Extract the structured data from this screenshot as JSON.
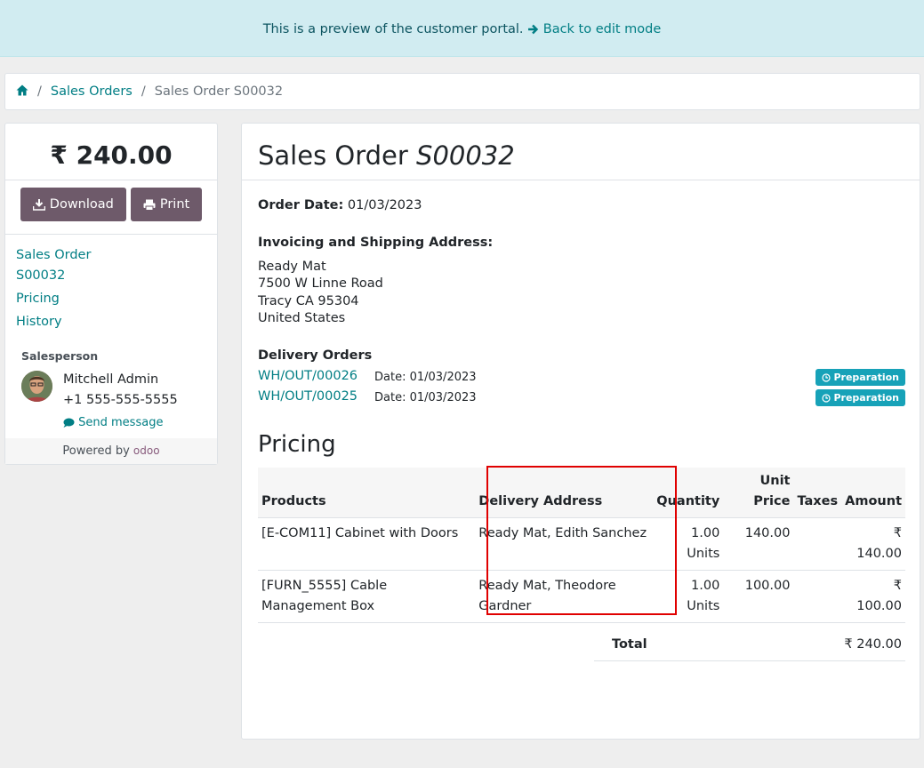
{
  "banner": {
    "text": "This is a preview of the customer portal.",
    "link": "Back to edit mode"
  },
  "breadcrumb": {
    "item1": "Sales Orders",
    "current": "Sales Order S00032"
  },
  "sidebar": {
    "amount": "₹ 240.00",
    "download_label": "Download",
    "print_label": "Print",
    "nav": [
      "Sales Order",
      "S00032",
      "Pricing",
      "History"
    ],
    "salesperson_label": "Salesperson",
    "salesperson_name": "Mitchell Admin",
    "salesperson_phone": "+1 555-555-5555",
    "send_message": "Send message",
    "powered_by": "Powered by",
    "odoo": "odoo"
  },
  "order": {
    "title_prefix": "Sales Order",
    "title_ref": "S00032",
    "order_date_label": "Order Date:",
    "order_date": "01/03/2023",
    "address_heading": "Invoicing and Shipping Address:",
    "address": [
      "Ready Mat",
      "7500 W Linne Road",
      "Tracy CA 95304",
      "United States"
    ],
    "delivery_heading": "Delivery Orders",
    "deliveries": [
      {
        "ref": "WH/OUT/00026",
        "date_label": "Date:",
        "date": "01/03/2023",
        "status": "Preparation"
      },
      {
        "ref": "WH/OUT/00025",
        "date_label": "Date:",
        "date": "01/03/2023",
        "status": "Preparation"
      }
    ],
    "pricing_heading": "Pricing",
    "columns": {
      "products": "Products",
      "delivery": "Delivery Address",
      "quantity": "Quantity",
      "unit_price_1": "Unit",
      "unit_price_2": "Price",
      "taxes": "Taxes",
      "amount": "Amount"
    },
    "lines": [
      {
        "product": "[E-COM11] Cabinet with Doors",
        "delivery": "Ready Mat, Edith Sanchez",
        "qty": "1.00",
        "uom": "Units",
        "price": "140.00",
        "taxes": "",
        "amount": "₹ 140.00"
      },
      {
        "product": "[FURN_5555] Cable Management Box",
        "delivery": "Ready Mat, Theodore Gardner",
        "qty": "1.00",
        "uom": "Units",
        "price": "100.00",
        "taxes": "",
        "amount": "₹ 100.00"
      }
    ],
    "total_label": "Total",
    "total": "₹ 240.00"
  },
  "colors": {
    "link": "#017e84",
    "button": "#6e5a6a",
    "badge": "#17a2b8",
    "highlight": "#e00000"
  }
}
